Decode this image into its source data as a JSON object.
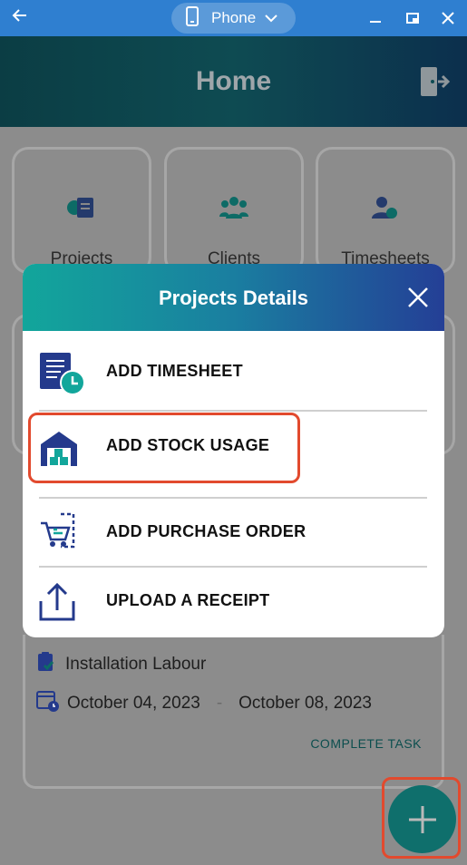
{
  "window": {
    "device_label": "Phone"
  },
  "header": {
    "title": "Home"
  },
  "tiles": [
    {
      "label": "Projects"
    },
    {
      "label": "Clients"
    },
    {
      "label": "Timesheets"
    }
  ],
  "task": {
    "name": "Installation Labour",
    "start_date": "October 04, 2023",
    "separator": "-",
    "end_date": "October 08, 2023",
    "action_label": "COMPLETE TASK"
  },
  "modal": {
    "title": "Projects Details",
    "items": [
      {
        "label": "ADD TIMESHEET",
        "icon": "timesheet-icon"
      },
      {
        "label": "ADD STOCK USAGE",
        "icon": "warehouse-icon"
      },
      {
        "label": "ADD PURCHASE ORDER",
        "icon": "cart-icon"
      },
      {
        "label": "UPLOAD A RECEIPT",
        "icon": "upload-icon"
      }
    ]
  },
  "colors": {
    "accent_teal": "#0f6f6c",
    "highlight_red": "#e24a2e",
    "icon_navy": "#243a8c",
    "icon_teal": "#12a69b"
  }
}
